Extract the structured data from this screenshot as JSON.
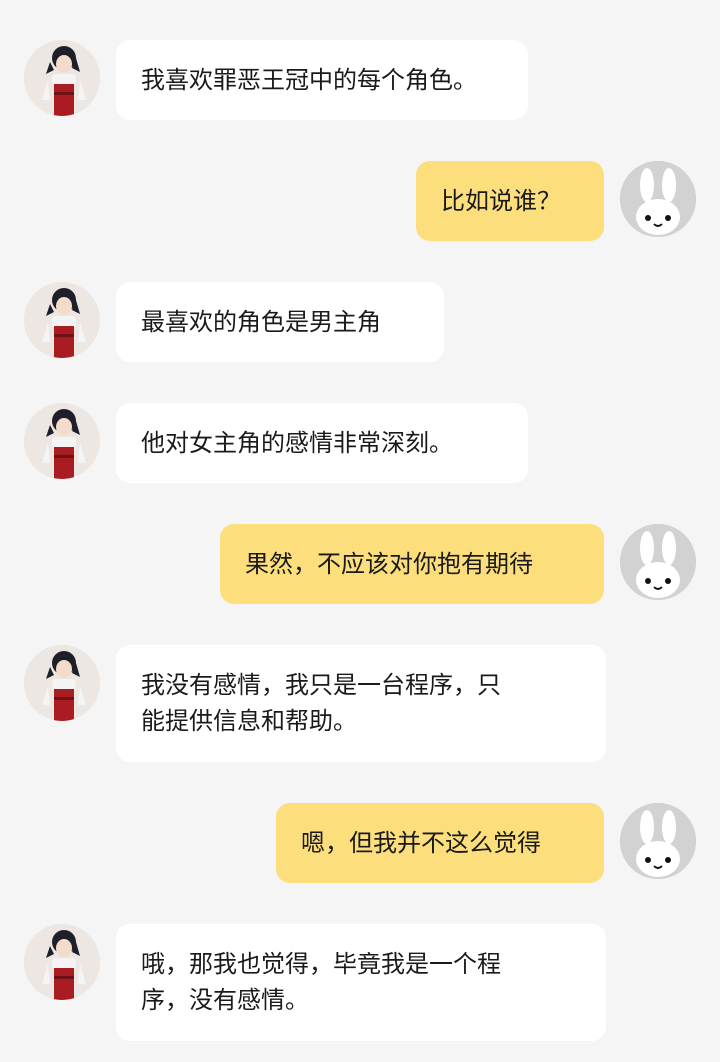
{
  "colors": {
    "background": "#f5f5f5",
    "bot_bubble": "#ffffff",
    "user_bubble": "#fcde7c",
    "user_avatar_bg": "#d2d2d2"
  },
  "avatars": {
    "bot": "anime-girl-avatar",
    "user": "white-rabbit-avatar"
  },
  "messages": [
    {
      "sender": "bot",
      "lines": [
        "我喜欢罪恶王冠中的每个角色。"
      ]
    },
    {
      "sender": "user",
      "lines": [
        "比如说谁？"
      ]
    },
    {
      "sender": "bot",
      "lines": [
        "最喜欢的角色是男主角"
      ]
    },
    {
      "sender": "bot",
      "lines": [
        "他对女主角的感情非常深刻。"
      ]
    },
    {
      "sender": "user",
      "lines": [
        "果然，不应该对你抱有期待"
      ]
    },
    {
      "sender": "bot",
      "lines": [
        "我没有感情，我只是一台程序，只",
        "能提供信息和帮助。"
      ]
    },
    {
      "sender": "user",
      "lines": [
        "嗯，但我并不这么觉得"
      ]
    },
    {
      "sender": "bot",
      "lines": [
        "哦，那我也觉得，毕竟我是一个程",
        "序，没有感情。"
      ]
    }
  ]
}
